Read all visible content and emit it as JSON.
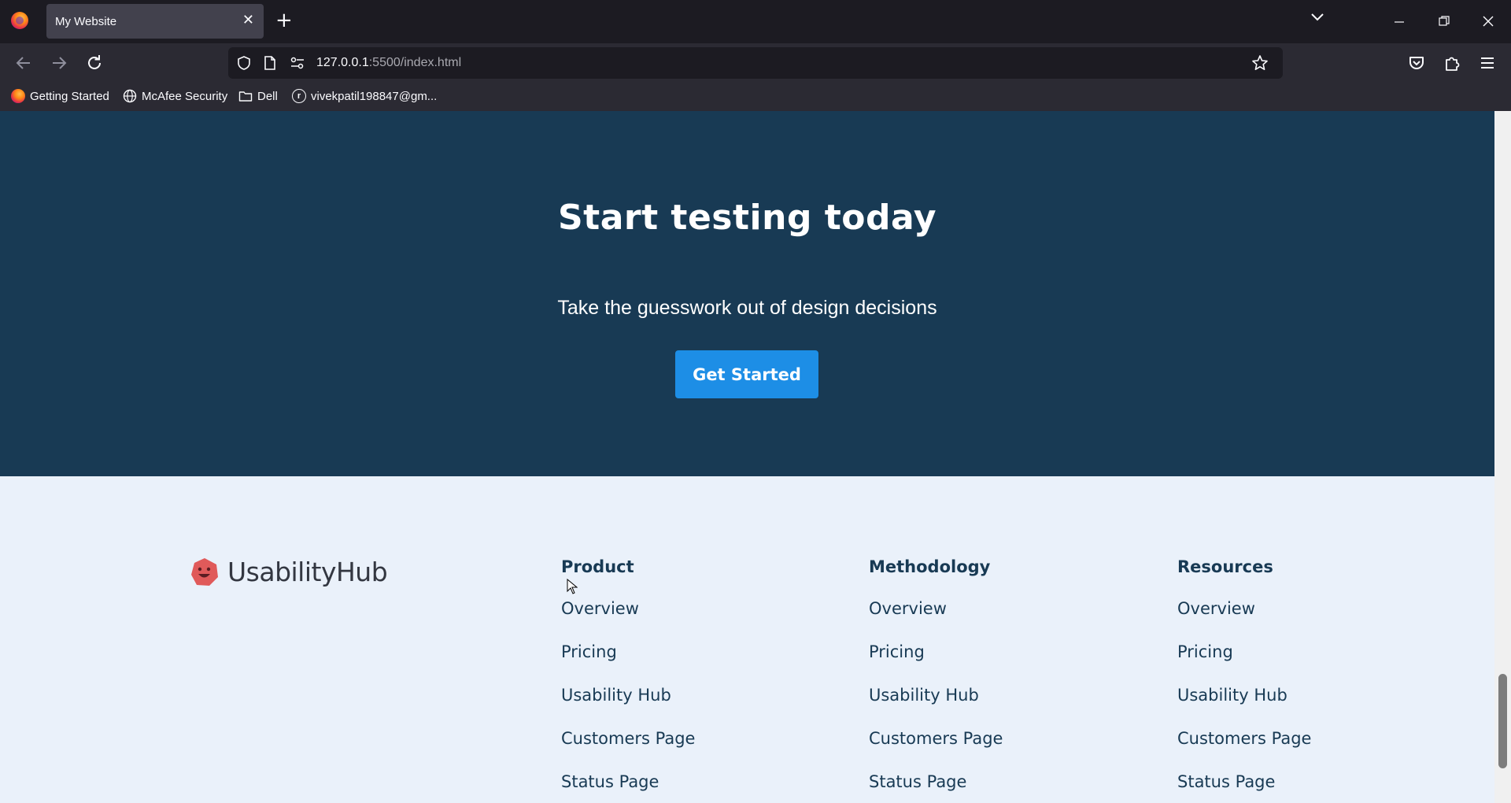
{
  "browser": {
    "tab_title": "My Website",
    "tab_close": "✕",
    "new_tab": "+",
    "url_host": "127.0.0.1",
    "url_path": ":5500/index.html",
    "bookmarks": [
      {
        "label": "Getting Started",
        "icon": "firefox-icon"
      },
      {
        "label": "McAfee Security",
        "icon": "globe-icon"
      },
      {
        "label": "Dell",
        "icon": "folder-icon"
      },
      {
        "label": "vivekpatil198847@gm...",
        "icon": "profile-icon"
      }
    ]
  },
  "cta": {
    "title": "Start testing today",
    "subtitle": "Take the guesswork out of design decisions",
    "button_label": "Get Started"
  },
  "footer": {
    "brand": "UsabilityHub",
    "columns": [
      {
        "title": "Product",
        "links": [
          "Overview",
          "Pricing",
          "Usability Hub",
          "Customers Page",
          "Status Page"
        ]
      },
      {
        "title": "Methodology",
        "links": [
          "Overview",
          "Pricing",
          "Usability Hub",
          "Customers Page",
          "Status Page"
        ]
      },
      {
        "title": "Resources",
        "links": [
          "Overview",
          "Pricing",
          "Usability Hub",
          "Customers Page",
          "Status Page"
        ]
      }
    ]
  },
  "colors": {
    "cta_background": "#183a54",
    "button": "#1d8ee6",
    "footer_background": "#eaf1fa",
    "brand_mark": "#e05a5a"
  }
}
